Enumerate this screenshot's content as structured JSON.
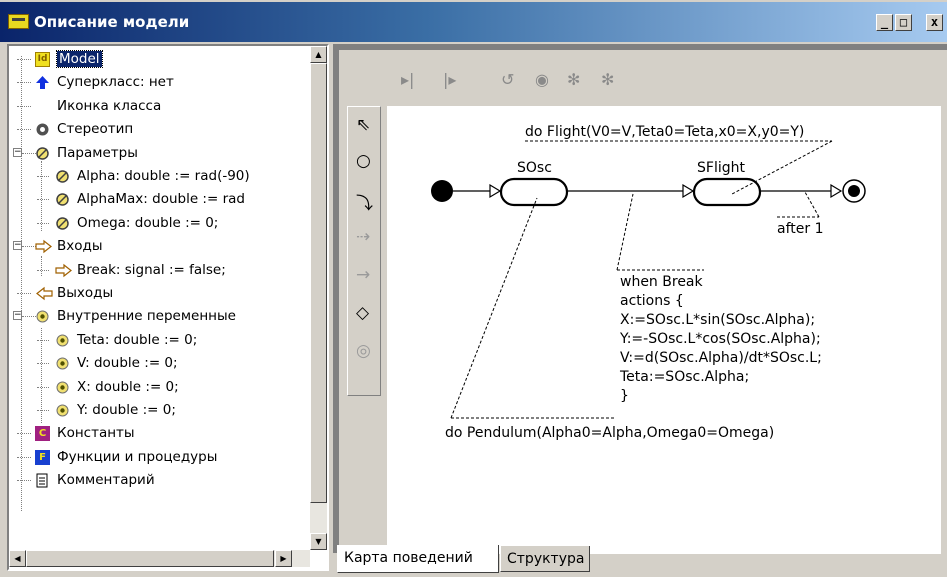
{
  "window": {
    "title": "Описание модели",
    "buttons": {
      "minimize": "_",
      "maximize": "□",
      "close": "x"
    }
  },
  "tree": {
    "items": [
      {
        "label": "Model",
        "icon": "id-badge-icon",
        "selected": true
      },
      {
        "label": "Суперкласс: нет",
        "icon": "blue-up-arrow-icon"
      },
      {
        "label": "Иконка класса",
        "icon": ""
      },
      {
        "label": "Стереотип",
        "icon": "gear-icon"
      },
      {
        "label": "Параметры",
        "icon": "parameter-icon",
        "expander": "−"
      },
      {
        "label": "Alpha: double := rad(-90)",
        "icon": "parameter-icon"
      },
      {
        "label": "AlphaMax: double := rad",
        "icon": "parameter-icon"
      },
      {
        "label": "Omega: double := 0;",
        "icon": "parameter-icon"
      },
      {
        "label": "Входы",
        "icon": "input-arrow-icon",
        "expander": "−"
      },
      {
        "label": "Break: signal := false;",
        "icon": "input-arrow-icon"
      },
      {
        "label": "Выходы",
        "icon": "output-arrow-icon"
      },
      {
        "label": "Внутренние переменные",
        "icon": "variable-icon",
        "expander": "−"
      },
      {
        "label": "Teta: double := 0;",
        "icon": "variable-icon"
      },
      {
        "label": "V: double := 0;",
        "icon": "variable-icon"
      },
      {
        "label": "X: double := 0;",
        "icon": "variable-icon"
      },
      {
        "label": "Y: double := 0;",
        "icon": "variable-icon"
      },
      {
        "label": "Константы",
        "icon": "constants-c-icon"
      },
      {
        "label": "Функции и процедуры",
        "icon": "functions-f-icon"
      },
      {
        "label": "Комментарий",
        "icon": "document-icon"
      }
    ],
    "badges": {
      "id": "Id",
      "c": "C",
      "f": "F"
    }
  },
  "diagram": {
    "state1": "SOsc",
    "state2": "SFlight",
    "flight_action": "do Flight(V0=V,Teta0=Teta,x0=X,y0=Y)",
    "pendulum_action": "do Pendulum(Alpha0=Alpha,Omega0=Omega)",
    "after": "after 1",
    "transition_lines": [
      "when Break",
      "actions {",
      " X:=SOsc.L*sin(SOsc.Alpha);",
      " Y:=-SOsc.L*cos(SOsc.Alpha);",
      " V:=d(SOsc.Alpha)/dt*SOsc.L;",
      " Teta:=SOsc.Alpha;",
      "}"
    ]
  },
  "tabs": [
    {
      "label": "Карта поведений",
      "active": true
    },
    {
      "label": "Структура",
      "active": false
    }
  ]
}
